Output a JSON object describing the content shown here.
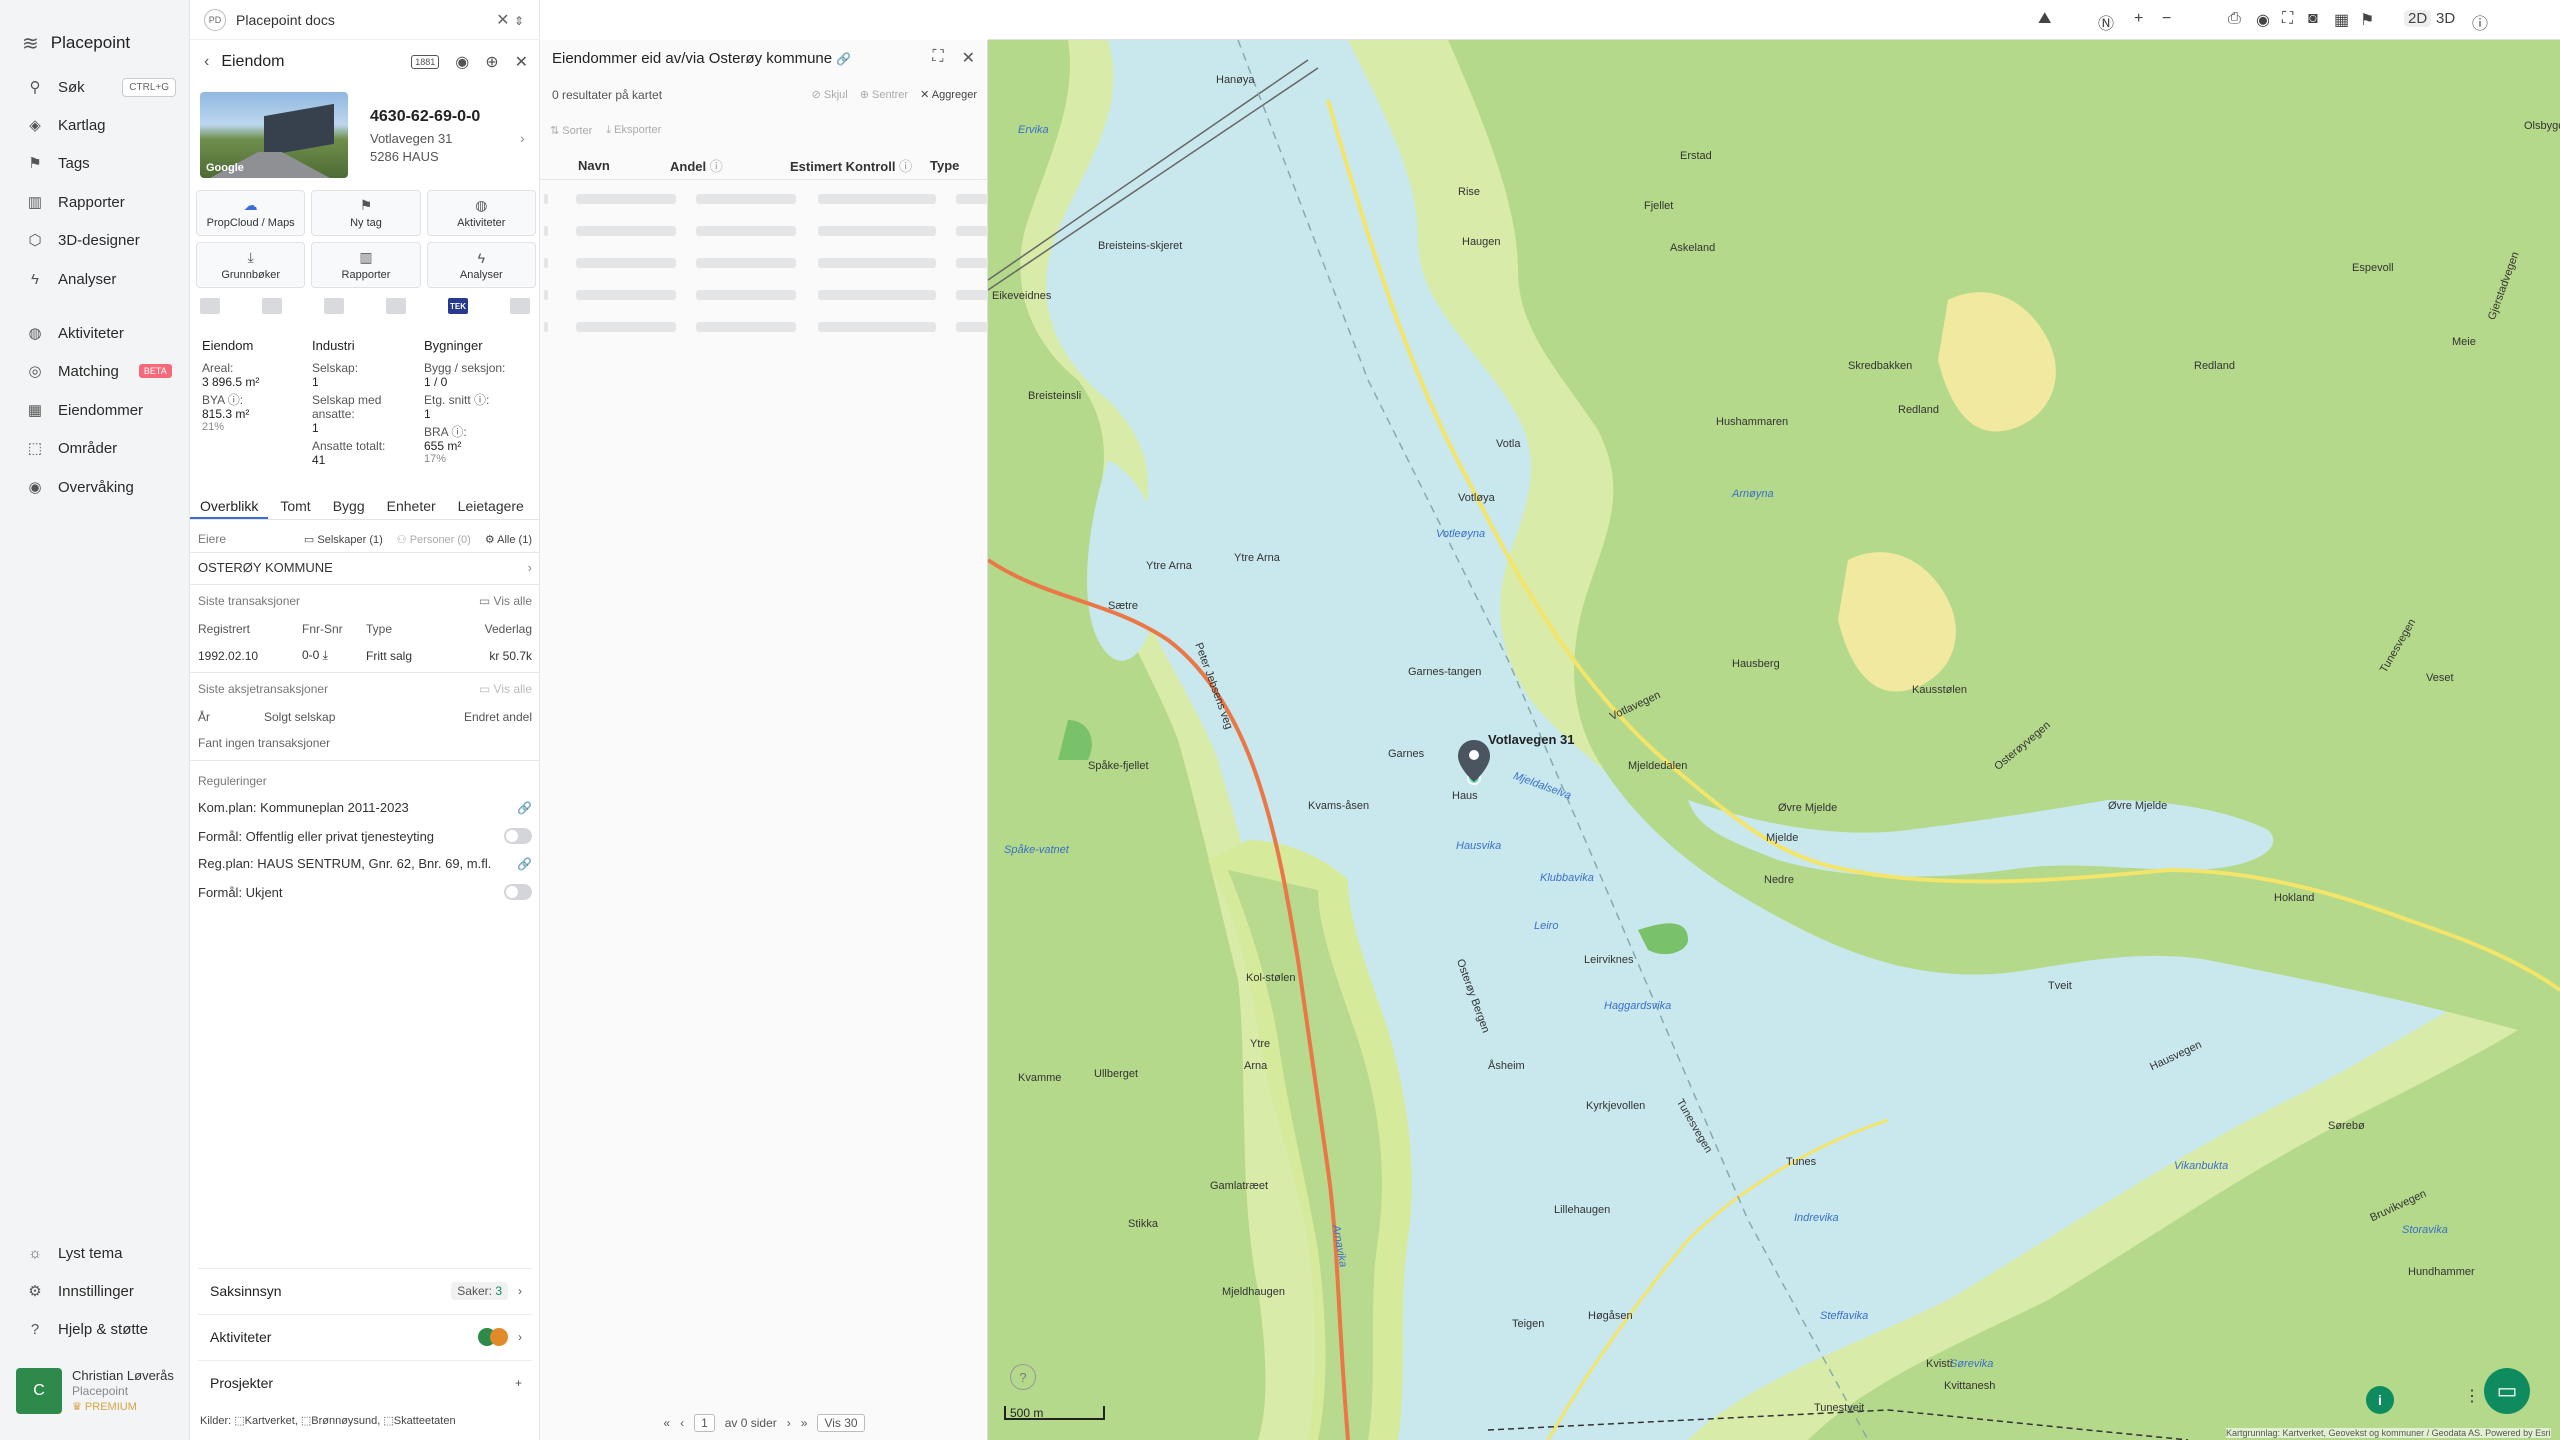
{
  "nav": {
    "brand": "Placepoint",
    "items": [
      {
        "label": "Søk",
        "icon": "search-icon",
        "shortcut": "CTRL+G"
      },
      {
        "label": "Kartlag",
        "icon": "layers-icon"
      },
      {
        "label": "Tags",
        "icon": "bookmark-icon"
      },
      {
        "label": "Rapporter",
        "icon": "chart-icon"
      },
      {
        "label": "3D-designer",
        "icon": "cube-icon"
      },
      {
        "label": "Analyser",
        "icon": "bolt-icon"
      },
      {
        "label": "Aktiviteter",
        "icon": "chat-icon"
      },
      {
        "label": "Matching",
        "icon": "target-icon",
        "badge": "BETA"
      },
      {
        "label": "Eiendommer",
        "icon": "building-icon"
      },
      {
        "label": "Områder",
        "icon": "area-icon"
      },
      {
        "label": "Overvåking",
        "icon": "monitor-icon"
      }
    ],
    "bottom": [
      {
        "label": "Lyst tema",
        "icon": "sun-icon"
      },
      {
        "label": "Innstillinger",
        "icon": "gear-icon"
      },
      {
        "label": "Hjelp & støtte",
        "icon": "help-icon"
      }
    ],
    "user": {
      "initial": "C",
      "name": "Christian Løverås",
      "org": "Placepoint",
      "plan": "PREMIUM"
    }
  },
  "property_panel": {
    "workspace_badge": "PD",
    "workspace": "Placepoint docs",
    "title": "Eiendom",
    "pill": "1881",
    "id": "4630-62-69-0-0",
    "address1": "Votlavegen 31",
    "address2": "5286 HAUS",
    "thumb_label": "Google",
    "tiles": [
      "PropCloud / Maps",
      "Ny tag",
      "Aktiviteter",
      "Grunnbøker",
      "Rapporter",
      "Analyser"
    ],
    "source_tek": "TEK",
    "stats": {
      "eiendom": {
        "title": "Eiendom",
        "areal_label": "Areal:",
        "areal": "3 896.5 m²",
        "bya_label": "BYA ⓘ:",
        "bya": "815.3 m²",
        "bya_pct": "21%"
      },
      "industri": {
        "title": "Industri",
        "selskap_label": "Selskap:",
        "selskap": "1",
        "ansatte_label": "Selskap med ansatte:",
        "ansatte": "1",
        "total_label": "Ansatte totalt:",
        "total": "41"
      },
      "bygninger": {
        "title": "Bygninger",
        "bygg_label": "Bygg / seksjon:",
        "bygg": "1 / 0",
        "etg_label": "Etg. snitt ⓘ:",
        "etg": "1",
        "bra_label": "BRA ⓘ:",
        "bra": "655 m²",
        "bra_pct": "17%"
      }
    },
    "tabs": [
      "Overblikk",
      "Tomt",
      "Bygg",
      "Enheter",
      "Leietagere"
    ],
    "owners": {
      "label": "Eiere",
      "selskaper": "Selskaper (1)",
      "personer": "Personer (0)",
      "alle": "Alle (1)",
      "owner": "OSTERØY KOMMUNE"
    },
    "transactions": {
      "title": "Siste transaksjoner",
      "vis_alle": "Vis alle",
      "cols": [
        "Registrert",
        "Fnr-Snr",
        "Type",
        "Vederlag"
      ],
      "row": [
        "1992.02.10",
        "0-0 ⤓",
        "Fritt salg",
        "kr 50.7k"
      ]
    },
    "share_tx": {
      "title": "Siste aksjetransaksjoner",
      "vis_alle": "Vis alle",
      "cols": [
        "År",
        "Solgt selskap",
        "Endret andel"
      ],
      "empty": "Fant ingen transaksjoner"
    },
    "regulations": {
      "title": "Reguleringer",
      "items": [
        "Kom.plan: Kommuneplan 2011-2023",
        "Formål: Offentlig eller privat tjenesteyting",
        "Reg.plan: HAUS SENTRUM, Gnr. 62, Bnr. 69, m.fl.",
        "Formål: Ukjent"
      ]
    },
    "sections": {
      "saksinnsyn": "Saksinnsyn",
      "saker_label": "Saker:",
      "saker": "3",
      "aktiviteter": "Aktiviteter",
      "prosjekter": "Prosjekter"
    },
    "kilder": "Kilder: ⬚Kartverket, ⬚Brønnøysund, ⬚Skatteetaten"
  },
  "results_panel": {
    "title": "Eiendommer eid av/via Osterøy kommune",
    "count": "0 resultater på kartet",
    "actions": [
      "Skjul",
      "Sentrer",
      "Aggreger"
    ],
    "tools": [
      "Sorter",
      "Eksporter"
    ],
    "columns": [
      "Navn",
      "Andel",
      "Estimert Kontroll",
      "Type"
    ],
    "pager": {
      "page": "1",
      "of": "av 0 sider",
      "per": "Vis 30"
    }
  },
  "map": {
    "view_2d": "2D",
    "view_3d": "3D",
    "scale": "500 m",
    "attribution": "Kartgrunnlag: Kartverket, Geovekst og kommuner / Geodata AS. Powered by Esri",
    "marker_label": "Votlavegen 31",
    "labels": [
      "Hanøya",
      "Ervika",
      "Breisteins-skjeret",
      "Eikeveidnes",
      "Breisteinsli",
      "Ytre Arna",
      "Sætre",
      "Peter Jebsens veg",
      "Spåke-fjellet",
      "Kvams-åsen",
      "Garnes-tangen",
      "Garnes",
      "Votla",
      "Votløya",
      "Votleøyna",
      "Hushammaren",
      "Rise",
      "Haugen",
      "Fjellet",
      "Askeland",
      "Erstad",
      "Skredbakken",
      "Arnøyna",
      "Votlavegen",
      "Hausberg",
      "Kausstølen",
      "Haus",
      "Hausvika",
      "Mjeldedalen",
      "Mjeldalselva",
      "Mjelde",
      "Nedre",
      "Øvre Mjelde",
      "Osterøyvegen",
      "Klubbavika",
      "Leiro",
      "Leirviknes",
      "Haggardsvika",
      "Osterøy Bergen",
      "Tunesvegen",
      "Tunes",
      "Indrevika",
      "Tunestveit",
      "Høgåsen",
      "Teigen",
      "Steffavika",
      "Sørevika",
      "Kvisti",
      "Kvittanesh",
      "Bruvikvegen",
      "Hundhammer",
      "Storavika",
      "Vikanbukta",
      "Hausvegen",
      "Tveit",
      "Hokland",
      "Øvre Mjelde",
      "Redland",
      "Espevoll",
      "Gjerstadvegen",
      "Redland",
      "Ytre Arna",
      "Arna",
      "Ytre",
      "Kol-stølen",
      "Mjeldhaugen",
      "Gamlatræet",
      "Stikka",
      "Kvamme",
      "Ullberget",
      "Spåke-vatnet",
      "Arnavika",
      "Åsheim",
      "Kyrkjevollen",
      "Tunesvegen",
      "Lillehaugen",
      "Sørebø",
      "Olsbygda",
      "Veset",
      "Meie"
    ]
  }
}
